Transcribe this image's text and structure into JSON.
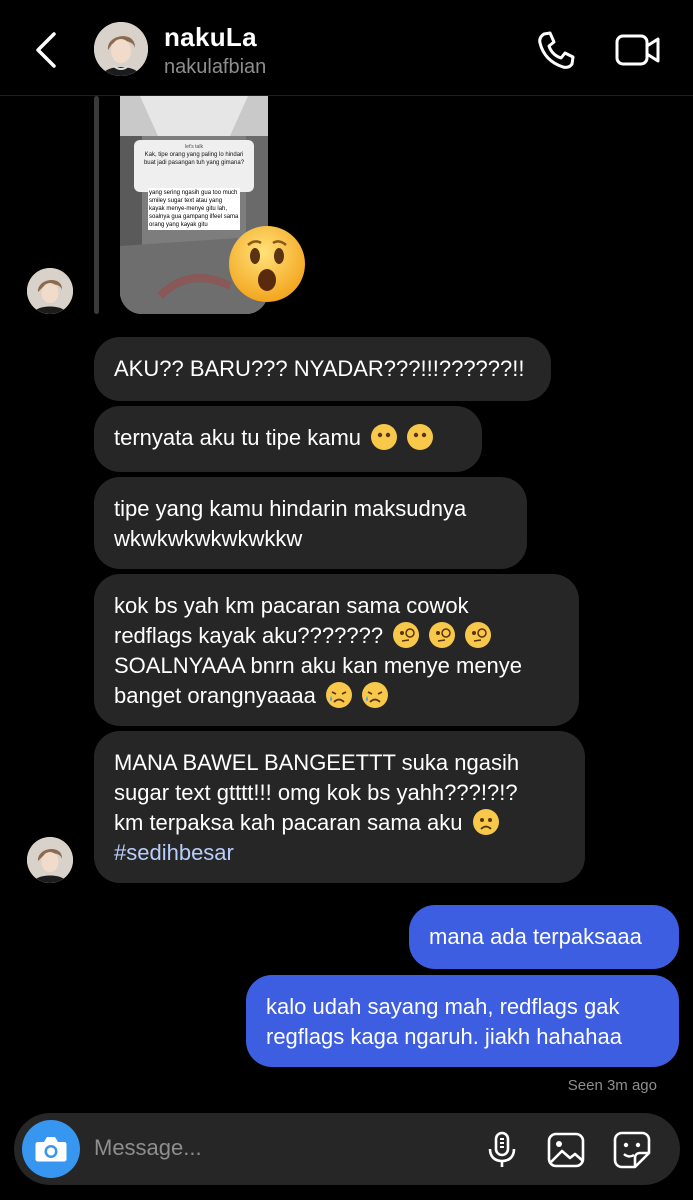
{
  "header": {
    "back_icon": "chevron-left-icon",
    "display_name": "nakuLa",
    "username": "nakulafbian",
    "call_icon": "phone-icon",
    "video_icon": "video-camera-icon"
  },
  "story_reply": {
    "card_title": "let's talk",
    "question": "Kak, tipe orang yang paling lo hindari buat jadi pasangan tuh yang gimana?",
    "answer": "yang sering ngasih gua too much smiley sugar text atau yang kayak menye-menye gitu lah, soalnya gua gampang ilfeel sama orang yang kayak gitu",
    "reaction_emoji": "😮"
  },
  "messages": [
    {
      "id": "m1",
      "direction": "incoming",
      "text": "AKU?? BARU??? NYADAR???!!!??????!!"
    },
    {
      "id": "m2",
      "direction": "incoming",
      "text": "ternyata aku tu tipe kamu",
      "emojis": [
        "😶",
        "😶"
      ]
    },
    {
      "id": "m3",
      "direction": "incoming",
      "line1": "tipe yang kamu hindarin maksudnya",
      "line2": "wkwkwkwkwkwkkw"
    },
    {
      "id": "m4",
      "direction": "incoming",
      "line1": "kok bs yah km pacaran sama cowok",
      "line2": "redflags kayak aku???????",
      "line2_emojis": [
        "🧐",
        "🧐",
        "🧐"
      ],
      "line3": "SOALNYAAA bnrn aku kan menye menye",
      "line4": "banget orangnyaaaa",
      "line4_emojis": [
        "😥",
        "😥"
      ]
    },
    {
      "id": "m5",
      "direction": "incoming",
      "line1": "MANA BAWEL BANGEETTT suka ngasih",
      "line2": "sugar text gtttt!!! omg kok bs yahh???!?!?",
      "line3": "km terpaksa kah pacaran sama aku",
      "line3_emoji": "☹️",
      "hashtag": "#sedihbesar"
    },
    {
      "id": "m6",
      "direction": "outgoing",
      "text": "mana ada terpaksaaa"
    },
    {
      "id": "m7",
      "direction": "outgoing",
      "line1": "kalo udah sayang mah, redflags gak",
      "line2": "regflags kaga ngaruh. jiakh hahahaa"
    }
  ],
  "seen_status": "Seen 3m ago",
  "composer": {
    "camera_icon": "camera-icon",
    "placeholder": "Message...",
    "mic_icon": "microphone-icon",
    "gallery_icon": "image-icon",
    "sticker_icon": "sticker-icon"
  },
  "colors": {
    "background": "#000000",
    "incoming_bubble": "#262626",
    "outgoing_bubble": "#3d5ee0",
    "accent": "#3797f0",
    "secondary_text": "#8e8e8e"
  }
}
